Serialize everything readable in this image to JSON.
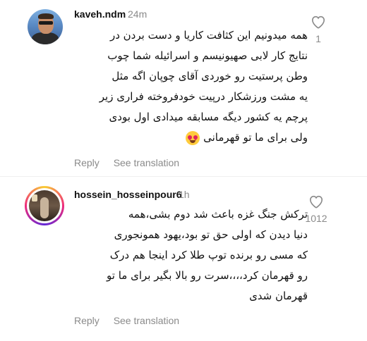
{
  "comments": [
    {
      "username": "kaveh.ndm",
      "time": "24m",
      "lines": [
        "همه میدونیم این کثافت کاریا و دست بردن در",
        "نتایج کار لابی صهیونیسم و اسرائیله شما چوب",
        "وطن پرستیت رو خوردی آقای چوپان اگه مثل",
        "یه مشت ورزشکار درپیت خودفروخته فراری زیر",
        "پرچم یه کشور دیگه مسابقه میدادی اول بودی",
        "ولی برای ما تو قهرمانی"
      ],
      "emoji_name": "heart-eyes-emoji",
      "reply_label": "Reply",
      "translate_label": "See translation",
      "like_count": "1",
      "like_icon": "heart-outline-icon"
    },
    {
      "username": "hossein_hosseinpour6",
      "time": "1h",
      "lines": [
        "ترکش جنگ غزه باعث شد دوم بشی،همه",
        "دنیا دیدن که اولی حق تو بود،یهود همونجوری",
        "که مسی رو برنده توپ طلا کرد اینجا هم درک",
        "رو قهرمان کرد،،،،سرت رو بالا بگیر برای ما تو",
        "قهرمان شدی"
      ],
      "reply_label": "Reply",
      "translate_label": "See translation",
      "like_count": "1012",
      "like_icon": "heart-outline-icon"
    }
  ],
  "colors": {
    "text": "#111111",
    "muted": "#8a8a8a",
    "story_ring": [
      "#f9ce34",
      "#ee2a7b",
      "#6228d7"
    ]
  }
}
